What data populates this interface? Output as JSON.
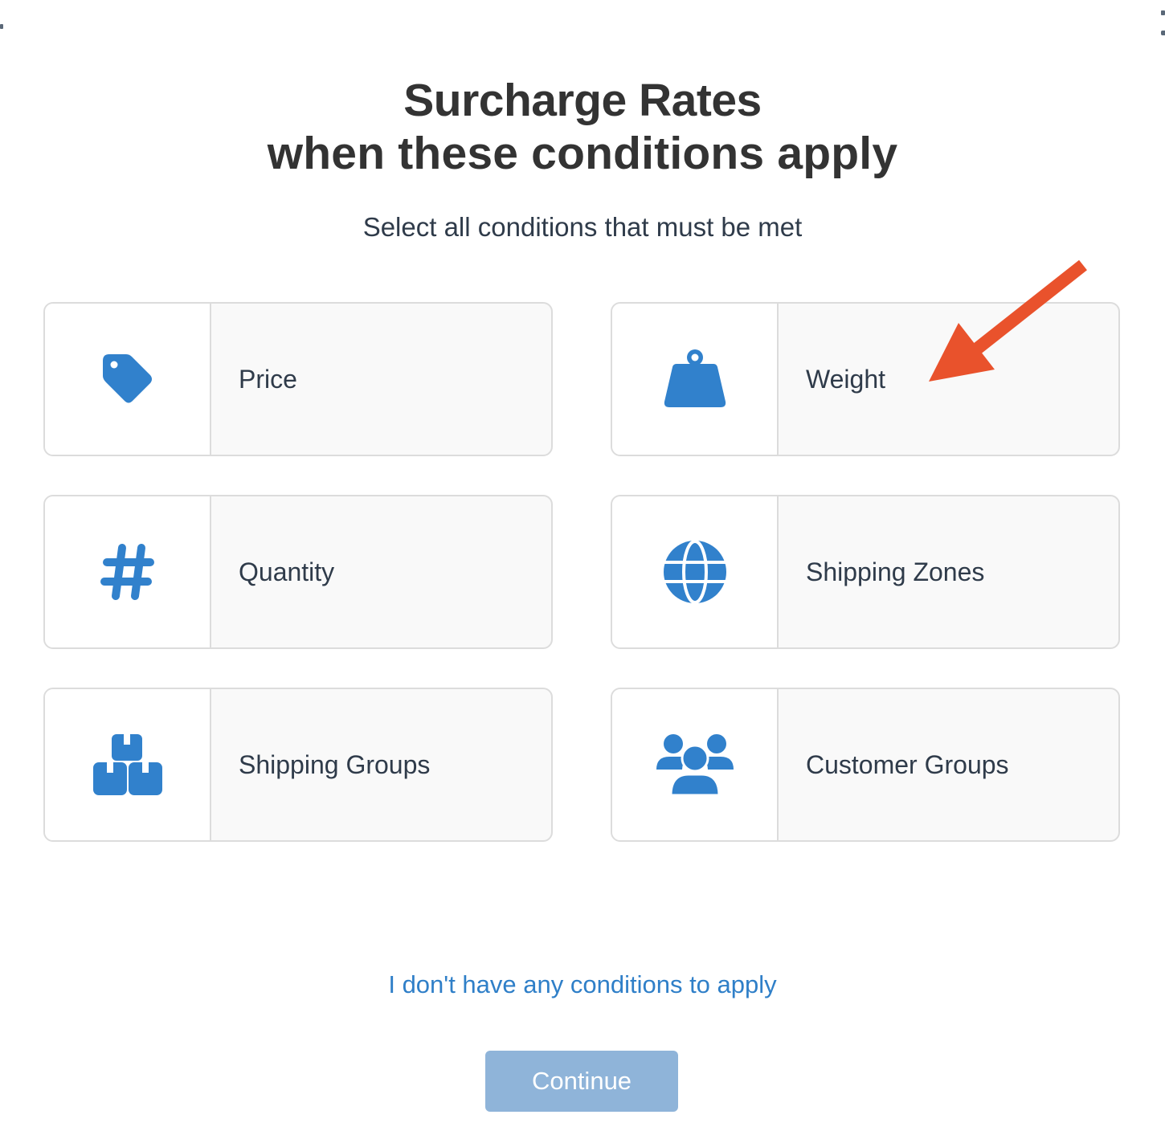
{
  "header": {
    "title": "Surcharge Rates",
    "subtitle": "when these conditions apply",
    "instruction": "Select all conditions that must be met"
  },
  "conditions": [
    {
      "label": "Price",
      "icon": "price-tag-icon"
    },
    {
      "label": "Weight",
      "icon": "weight-icon"
    },
    {
      "label": "Quantity",
      "icon": "hashtag-icon"
    },
    {
      "label": "Shipping Zones",
      "icon": "globe-icon"
    },
    {
      "label": "Shipping Groups",
      "icon": "boxes-icon"
    },
    {
      "label": "Customer Groups",
      "icon": "users-icon"
    }
  ],
  "annotation": {
    "type": "arrow",
    "points_to": "Weight",
    "color": "#e9522c"
  },
  "footer": {
    "no_conditions_link": "I don't have any conditions to apply",
    "continue_label": "Continue"
  },
  "colors": {
    "icon": "#3181cc",
    "link": "#2f7fc8",
    "continue_button": "#8fb4d9",
    "text": "#2f3b4a",
    "title": "#333333"
  }
}
